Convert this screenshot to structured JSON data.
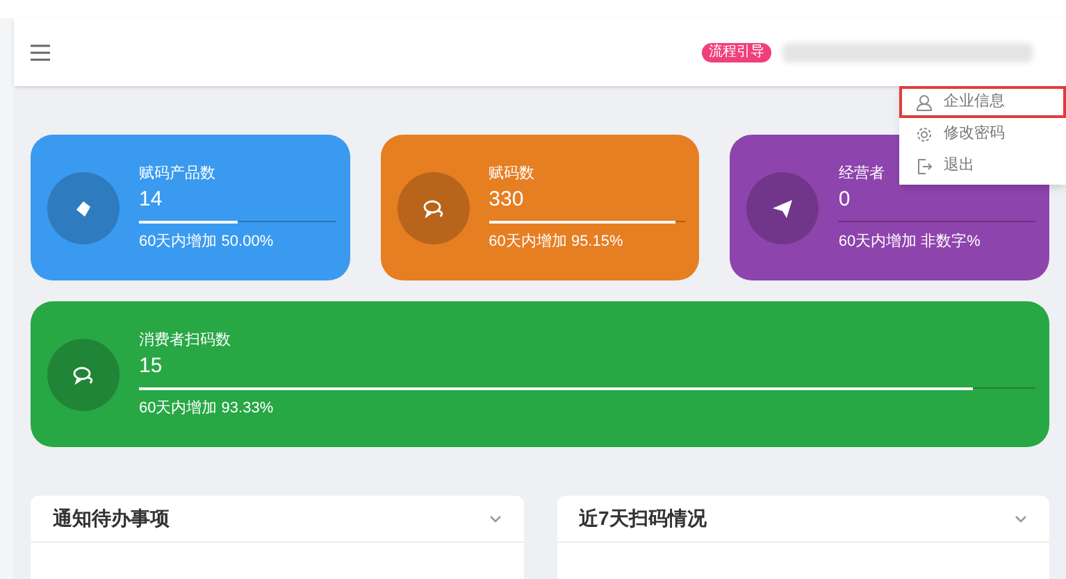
{
  "header": {
    "guide_badge": "流程引导"
  },
  "user_menu": {
    "items": [
      {
        "label": "企业信息",
        "selected": true
      },
      {
        "label": "修改密码",
        "selected": false
      },
      {
        "label": "退出",
        "selected": false
      }
    ]
  },
  "stat_cards": [
    {
      "title": "赋码产品数",
      "value": "14",
      "level": 0.5,
      "footer": "60天内增加 50.00%",
      "color": "#3a9af0"
    },
    {
      "title": "赋码数",
      "value": "330",
      "level": 0.95,
      "footer": "60天内增加 95.15%",
      "color": "#e67e22"
    },
    {
      "title": "经营者",
      "value": "0",
      "level": 0,
      "footer": "60天内增加 非数字%",
      "color": "#8e44ad"
    },
    {
      "title": "消费者扫码数",
      "value": "15",
      "level": 0.93,
      "footer": "60天内增加 93.33%",
      "color": "#28a745"
    }
  ],
  "panels": [
    {
      "title": "通知待办事项"
    },
    {
      "title": "近7天扫码情况"
    }
  ]
}
